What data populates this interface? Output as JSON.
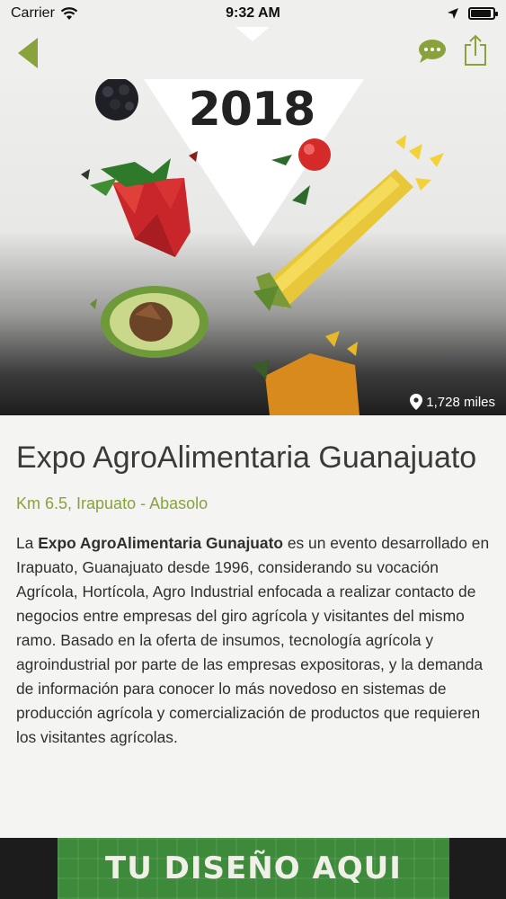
{
  "status_bar": {
    "carrier": "Carrier",
    "time": "9:32 AM",
    "battery_level": 0.9
  },
  "nav": {
    "back_icon": "chevron-left-icon",
    "chat_icon": "chat-bubble-icon",
    "share_icon": "share-icon",
    "accent_color": "#8aa23c"
  },
  "hero": {
    "year_text": "2018",
    "distance": "1,728 miles",
    "distance_icon": "location-pin-icon"
  },
  "event": {
    "title": "Expo AgroAlimentaria Guanajuato",
    "address": "Km 6.5, Irapuato - Abasolo",
    "description_prefix": "La ",
    "description_bold": "Expo AgroAlimentaria Gunajuato",
    "description_rest": " es un evento desarrollado en Irapuato, Guanajuato desde 1996, considerando su vocación Agrícola, Hortícola, Agro Industrial enfocada a realizar contacto de negocios entre empresas del giro agrícola y visitantes del mismo ramo. Basado en la oferta de insumos, tecnología agrícola y agroindustrial por parte de las empresas expositoras, y la demanda de información para conocer lo más novedoso en sistemas de producción agrícola y comercialización de productos que requieren los visitantes agrícolas."
  },
  "banner": {
    "text": "TU DISEÑO AQUI",
    "color": "#3c8a3a"
  }
}
